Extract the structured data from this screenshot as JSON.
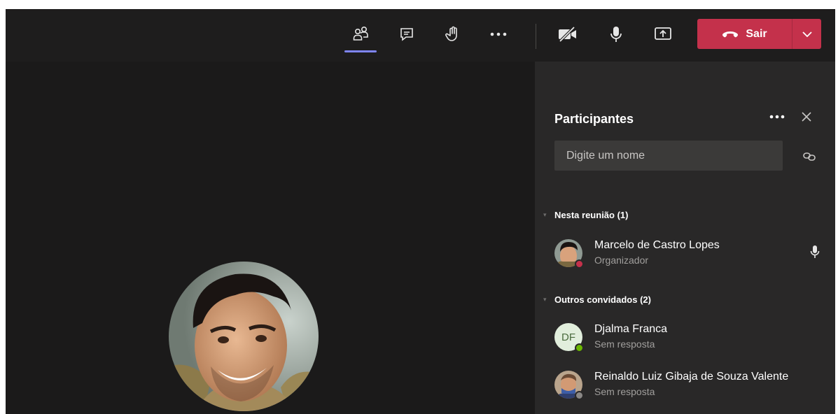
{
  "toolbar": {
    "buttons": [
      {
        "name": "participants",
        "icon": "participants-icon",
        "active": true
      },
      {
        "name": "chat",
        "icon": "chat-icon"
      },
      {
        "name": "raise-hand",
        "icon": "hand-icon"
      },
      {
        "name": "more",
        "icon": "more-icon"
      },
      {
        "name": "camera",
        "icon": "camera-off-icon"
      },
      {
        "name": "mic",
        "icon": "mic-icon"
      },
      {
        "name": "share",
        "icon": "share-screen-icon"
      }
    ],
    "leave_label": "Sair",
    "leave_color": "#c4314b",
    "active_indicator_color": "#7f85f5"
  },
  "panel": {
    "title": "Participantes",
    "search_placeholder": "Digite um nome",
    "sections": [
      {
        "label": "Nesta reunião (1)",
        "people": [
          {
            "name": "Marcelo de Castro Lopes",
            "role": "Organizador",
            "status_color": "#c4314b",
            "has_mic": true
          }
        ]
      },
      {
        "label": "Outros convidados (2)",
        "people": [
          {
            "name": "Djalma Franca",
            "initials": "DF",
            "role": "Sem resposta",
            "status_color": "#6bb700"
          },
          {
            "name": "Reinaldo Luiz Gibaja de Souza Valente",
            "role": "Sem resposta",
            "status_color": "#8a8886"
          }
        ]
      }
    ]
  }
}
